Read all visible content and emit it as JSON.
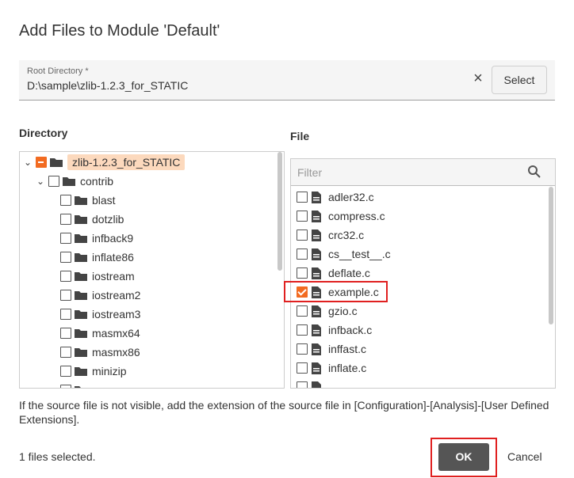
{
  "dialog": {
    "title": "Add Files to Module 'Default'"
  },
  "root": {
    "label": "Root Directory *",
    "value": "D:\\sample\\zlib-1.2.3_for_STATIC",
    "clear_icon": "close-icon",
    "select_label": "Select"
  },
  "directory": {
    "heading": "Directory",
    "items": [
      {
        "label": "zlib-1.2.3_for_STATIC",
        "state": "indeterminate",
        "expanded": true
      },
      {
        "label": "contrib",
        "state": "unchecked",
        "expanded": true
      },
      {
        "label": "blast",
        "state": "unchecked"
      },
      {
        "label": "dotzlib",
        "state": "unchecked"
      },
      {
        "label": "infback9",
        "state": "unchecked"
      },
      {
        "label": "inflate86",
        "state": "unchecked"
      },
      {
        "label": "iostream",
        "state": "unchecked"
      },
      {
        "label": "iostream2",
        "state": "unchecked"
      },
      {
        "label": "iostream3",
        "state": "unchecked"
      },
      {
        "label": "masmx64",
        "state": "unchecked"
      },
      {
        "label": "masmx86",
        "state": "unchecked"
      },
      {
        "label": "minizip",
        "state": "unchecked"
      }
    ]
  },
  "file": {
    "heading": "File",
    "filter_placeholder": "Filter",
    "filter_value": "",
    "items": [
      {
        "label": "adler32.c",
        "checked": false
      },
      {
        "label": "compress.c",
        "checked": false
      },
      {
        "label": "crc32.c",
        "checked": false
      },
      {
        "label": "cs__test__.c",
        "checked": false
      },
      {
        "label": "deflate.c",
        "checked": false
      },
      {
        "label": "example.c",
        "checked": true
      },
      {
        "label": "gzio.c",
        "checked": false
      },
      {
        "label": "infback.c",
        "checked": false
      },
      {
        "label": "inffast.c",
        "checked": false
      },
      {
        "label": "inflate.c",
        "checked": false
      }
    ]
  },
  "hint": "If the source file is not visible, add the extension of the source file in [Configuration]-[Analysis]-[User Defined Extensions].",
  "footer": {
    "selected_count": "1 files selected.",
    "ok_label": "OK",
    "cancel_label": "Cancel"
  },
  "colors": {
    "accent": "#f26b21",
    "highlight": "#e02020",
    "ok_button": "#555555"
  }
}
